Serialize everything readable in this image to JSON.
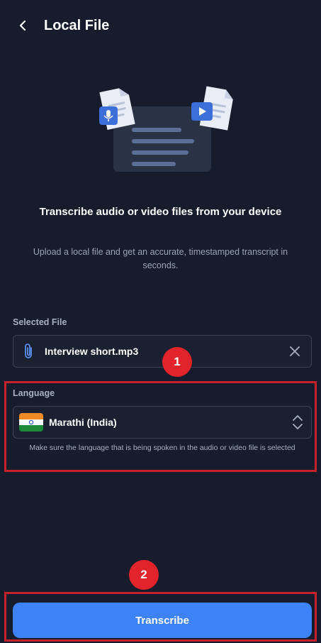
{
  "header": {
    "title": "Local File",
    "back_icon": "chevron-left-icon"
  },
  "illustration": {
    "icons": [
      "audio-file-icon",
      "video-file-icon",
      "document-icon"
    ]
  },
  "hero": {
    "title": "Transcribe audio or video files from your device",
    "subtitle": "Upload a local file and get an accurate, timestamped transcript in seconds."
  },
  "selected_file": {
    "label": "Selected File",
    "file_name": "Interview short.mp3",
    "attach_icon": "paperclip-icon",
    "clear_icon": "close-icon"
  },
  "language": {
    "label": "Language",
    "value": "Marathi (India)",
    "flag_icon": "india-flag-icon",
    "hint": "Make sure the language that is being spoken in the audio or video file is selected"
  },
  "annotations": {
    "marker_1": "1",
    "marker_2": "2",
    "highlight_color": "#c4222b",
    "marker_color": "#e3232b"
  },
  "actions": {
    "transcribe_label": "Transcribe",
    "accent_color": "#3d82f7"
  }
}
